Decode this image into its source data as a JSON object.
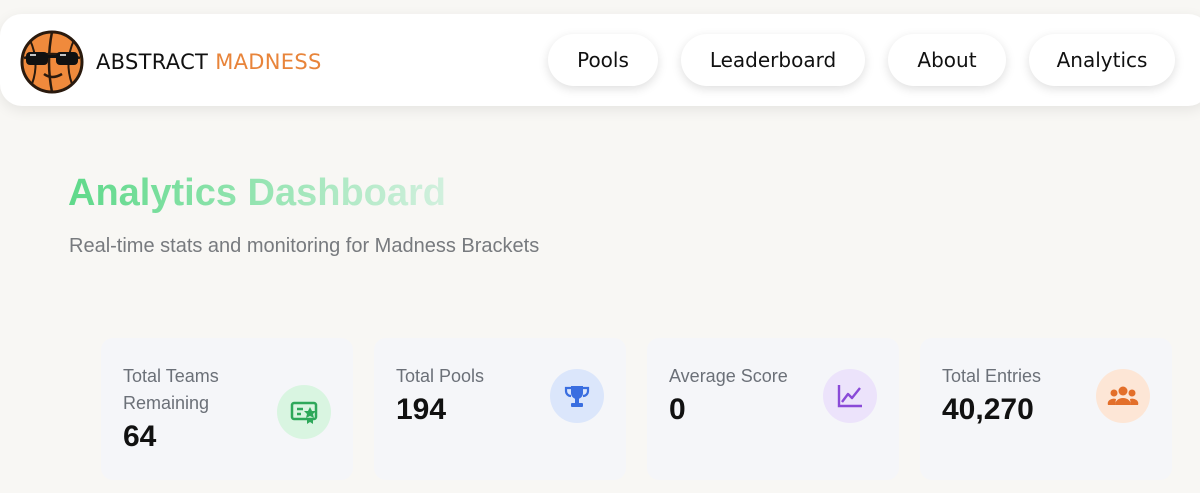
{
  "brand": {
    "name_primary": "ABSTRACT",
    "name_accent": "MADNESS"
  },
  "nav": {
    "items": [
      {
        "label": "Pools"
      },
      {
        "label": "Leaderboard"
      },
      {
        "label": "About"
      },
      {
        "label": "Analytics"
      }
    ]
  },
  "hero": {
    "title": "Analytics Dashboard",
    "subtitle": "Real-time stats and monitoring for Madness Brackets"
  },
  "stats": [
    {
      "label": "Total Teams Remaining",
      "value": "64",
      "icon": "ticket-icon",
      "icon_bg": "#d9f5e1",
      "icon_color": "#2ea85a"
    },
    {
      "label": "Total Pools",
      "value": "194",
      "icon": "trophy-icon",
      "icon_bg": "#dbe6fb",
      "icon_color": "#3a6ee0"
    },
    {
      "label": "Average Score",
      "value": "0",
      "icon": "line-chart-icon",
      "icon_bg": "#ece3fb",
      "icon_color": "#8a4ad8"
    },
    {
      "label": "Total Entries",
      "value": "40,270",
      "icon": "users-icon",
      "icon_bg": "#fde6d6",
      "icon_color": "#e36f2a"
    }
  ],
  "colors": {
    "accent": "#e8843a",
    "title_green": "#5fd98a"
  }
}
